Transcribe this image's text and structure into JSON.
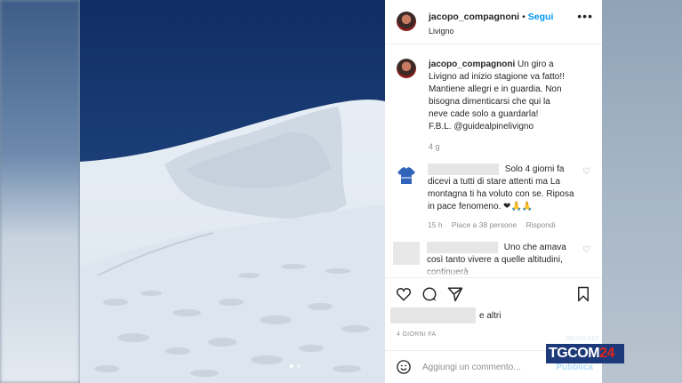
{
  "post": {
    "username": "jacopo_compagnoni",
    "follow_label": "Segui",
    "location": "Livigno",
    "more_icon": "more-icon"
  },
  "caption": {
    "username": "jacopo_compagnoni",
    "text_line1": "Un giro a Livigno ad inizio stagione va fatto!! Mantiene allegri e in guardia. Non bisogna dimenticarsi che qui la neve cade solo a guardarla!",
    "text_line2": "F.B.L. @guidealpinelivigno",
    "time": "4 g"
  },
  "comments": [
    {
      "text": "Solo 4 giorni fa dicevi a tutti di stare attenti ma La montagna ti ha voluto con se. Riposa in pace fenomeno. ❤🙏🙏",
      "time": "15 h",
      "likes": "Piace a 38 persone",
      "reply": "Rispondi"
    },
    {
      "text": "Uno che amava così tanto vivere a quelle altitudini, continuerà"
    }
  ],
  "likes_suffix": "e altri",
  "date": "4 GIORNI FA",
  "add_comment_placeholder": "Aggiungi un commento...",
  "publish_label": "Pubblica",
  "logo": {
    "top": "MEDIASET",
    "brand": "TGCOM",
    "number": "24"
  },
  "colors": {
    "accent": "#0095f6",
    "heart": "#ed4956",
    "logo_blue": "#1c3a7a",
    "logo_red": "#e1231a"
  }
}
